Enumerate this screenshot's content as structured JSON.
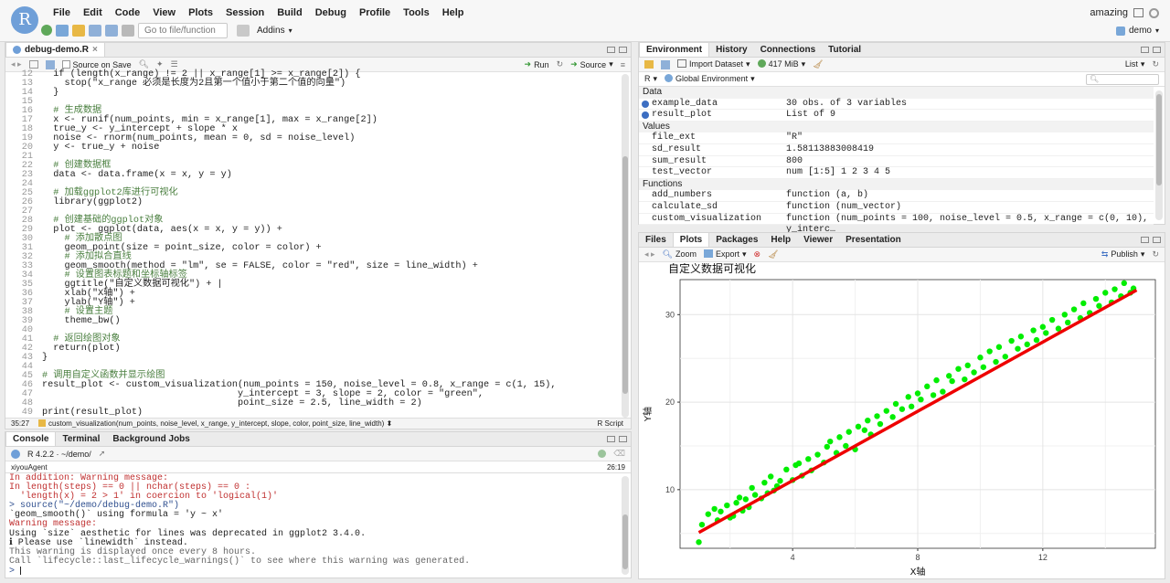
{
  "app": {
    "logo": "R",
    "menus": [
      "File",
      "Edit",
      "Code",
      "View",
      "Plots",
      "Session",
      "Build",
      "Debug",
      "Profile",
      "Tools",
      "Help"
    ],
    "goto_placeholder": "Go to file/function",
    "addins": "Addins",
    "user": "amazing",
    "project": "demo"
  },
  "editor": {
    "tab": "debug-demo.R",
    "source_on_save": "Source on Save",
    "run": "Run",
    "source": "Source",
    "status_pos": "35:27",
    "status_fn": "custom_visualization(num_points, noise_level, x_range, y_intercept, slope, color, point_size, line_width) ⬍",
    "status_lang": "R Script",
    "lines": [
      {
        "n": "12",
        "t": "  if (length(x_range) != 2 || x_range[1] >= x_range[2]) {"
      },
      {
        "n": "13",
        "t": "    stop(\"x_range 必须是长度为2且第一个值小于第二个值的向量\")"
      },
      {
        "n": "14",
        "t": "  }"
      },
      {
        "n": "15",
        "t": ""
      },
      {
        "n": "16",
        "t": "  # 生成数据"
      },
      {
        "n": "17",
        "t": "  x <- runif(num_points, min = x_range[1], max = x_range[2])"
      },
      {
        "n": "18",
        "t": "  true_y <- y_intercept + slope * x"
      },
      {
        "n": "19",
        "t": "  noise <- rnorm(num_points, mean = 0, sd = noise_level)"
      },
      {
        "n": "20",
        "t": "  y <- true_y + noise"
      },
      {
        "n": "21",
        "t": ""
      },
      {
        "n": "22",
        "t": "  # 创建数据框"
      },
      {
        "n": "23",
        "t": "  data <- data.frame(x = x, y = y)"
      },
      {
        "n": "24",
        "t": ""
      },
      {
        "n": "25",
        "t": "  # 加载ggplot2库进行可视化"
      },
      {
        "n": "26",
        "t": "  library(ggplot2)"
      },
      {
        "n": "27",
        "t": ""
      },
      {
        "n": "28",
        "t": "  # 创建基础的ggplot对象"
      },
      {
        "n": "29",
        "t": "  plot <- ggplot(data, aes(x = x, y = y)) +"
      },
      {
        "n": "30",
        "t": "    # 添加散点图"
      },
      {
        "n": "31",
        "t": "    geom_point(size = point_size, color = color) +"
      },
      {
        "n": "32",
        "t": "    # 添加拟合直线"
      },
      {
        "n": "33",
        "t": "    geom_smooth(method = \"lm\", se = FALSE, color = \"red\", size = line_width) +"
      },
      {
        "n": "34",
        "t": "    # 设置图表标题和坐标轴标签"
      },
      {
        "n": "35",
        "t": "    ggtitle(\"自定义数据可视化\") + |"
      },
      {
        "n": "36",
        "t": "    xlab(\"X轴\") +"
      },
      {
        "n": "37",
        "t": "    ylab(\"Y轴\") +"
      },
      {
        "n": "38",
        "t": "    # 设置主题"
      },
      {
        "n": "39",
        "t": "    theme_bw()"
      },
      {
        "n": "40",
        "t": ""
      },
      {
        "n": "41",
        "t": "  # 返回绘图对象"
      },
      {
        "n": "42",
        "t": "  return(plot)"
      },
      {
        "n": "43",
        "t": "}"
      },
      {
        "n": "44",
        "t": ""
      },
      {
        "n": "45",
        "t": "# 调用自定义函数并显示绘图"
      },
      {
        "n": "46",
        "t": "result_plot <- custom_visualization(num_points = 150, noise_level = 0.8, x_range = c(1, 15),"
      },
      {
        "n": "47",
        "t": "                                   y_intercept = 3, slope = 2, color = \"green\","
      },
      {
        "n": "48",
        "t": "                                   point_size = 2.5, line_width = 2)"
      },
      {
        "n": "49",
        "t": "print(result_plot)"
      }
    ]
  },
  "console": {
    "tabs": [
      "Console",
      "Terminal",
      "Background Jobs"
    ],
    "rversion": "R 4.2.2 · ~/demo/",
    "agent": "xiyouAgent",
    "agent_pos": "26:19",
    "lines": [
      {
        "t": "In addition: Warning message:",
        "c": "#c03030"
      },
      {
        "t": "In length(steps) == 0 || nchar(steps) == 0 :",
        "c": "#c03030"
      },
      {
        "t": "  'length(x) = 2 > 1' in coercion to 'logical(1)'",
        "c": "#c03030"
      },
      {
        "t": "> source(\"~/demo/debug-demo.R\")",
        "c": "#2f4f8f"
      },
      {
        "t": "`geom_smooth()` using formula = 'y ~ x'",
        "c": "#222"
      },
      {
        "t": "Warning message:",
        "c": "#c03030"
      },
      {
        "t": "Using `size` aesthetic for lines was deprecated in ggplot2 3.4.0.",
        "c": "#222"
      },
      {
        "t": "ℹ Please use `linewidth` instead.",
        "c": "#222"
      },
      {
        "t": "This warning is displayed once every 8 hours.",
        "c": "#666"
      },
      {
        "t": "Call `lifecycle::last_lifecycle_warnings()` to see where this warning was generated.",
        "c": "#666"
      },
      {
        "t": "> ",
        "c": "#2f4f8f"
      }
    ]
  },
  "env": {
    "tabs": [
      "Environment",
      "History",
      "Connections",
      "Tutorial"
    ],
    "import": "Import Dataset",
    "mem": "417 MiB",
    "list": "List",
    "lang": "R",
    "scope": "Global Environment",
    "sections": {
      "data": "Data",
      "values": "Values",
      "functions": "Functions"
    },
    "data": [
      {
        "k": "example_data",
        "v": "30 obs. of 3 variables"
      },
      {
        "k": "result_plot",
        "v": "List of  9"
      }
    ],
    "values": [
      {
        "k": "file_ext",
        "v": "\"R\""
      },
      {
        "k": "sd_result",
        "v": "1.58113883008419"
      },
      {
        "k": "sum_result",
        "v": "800"
      },
      {
        "k": "test_vector",
        "v": "num [1:5] 1 2 3 4 5"
      }
    ],
    "functions": [
      {
        "k": "add_numbers",
        "v": "function (a, b)"
      },
      {
        "k": "calculate_sd",
        "v": "function (num_vector)"
      },
      {
        "k": "custom_visualization",
        "v": "function (num_points = 100, noise_level = 0.5, x_range = c(0, 10), y_interc…"
      }
    ]
  },
  "files": {
    "tabs": [
      "Files",
      "Plots",
      "Packages",
      "Help",
      "Viewer",
      "Presentation"
    ],
    "zoom": "Zoom",
    "export": "Export",
    "publish": "Publish"
  },
  "chart_data": {
    "type": "scatter",
    "title": "自定义数据可视化",
    "xlabel": "X轴",
    "ylabel": "Y轴",
    "xlim": [
      0.4,
      15.6
    ],
    "ylim": [
      3.3,
      34.0
    ],
    "xticks": [
      4,
      8,
      12
    ],
    "yticks": [
      10,
      20,
      30
    ],
    "grid": true,
    "point_color": "#00ee00",
    "line_color": "#ee0000",
    "fit": {
      "x": [
        1,
        15
      ],
      "y": [
        5.1,
        32.8
      ]
    },
    "series": [
      {
        "x": [
          1.0,
          1.1,
          1.3,
          1.5,
          1.6,
          1.7,
          1.9,
          2.0,
          2.1,
          2.2,
          2.3,
          2.4,
          2.5,
          2.6,
          2.7,
          2.8,
          3.0,
          3.1,
          3.2,
          3.3,
          3.4,
          3.5,
          3.6,
          3.8,
          4.0,
          4.1,
          4.2,
          4.3,
          4.5,
          4.6,
          4.8,
          5.0,
          5.1,
          5.2,
          5.4,
          5.5,
          5.7,
          5.8,
          6.0,
          6.1,
          6.3,
          6.4,
          6.5,
          6.7,
          6.8,
          7.0,
          7.2,
          7.3,
          7.5,
          7.7,
          7.8,
          8.0,
          8.1,
          8.3,
          8.5,
          8.6,
          8.8,
          9.0,
          9.1,
          9.3,
          9.5,
          9.6,
          9.8,
          10.0,
          10.1,
          10.3,
          10.5,
          10.6,
          10.8,
          11.0,
          11.2,
          11.3,
          11.5,
          11.7,
          11.8,
          12.0,
          12.1,
          12.3,
          12.5,
          12.7,
          12.8,
          13.0,
          13.2,
          13.3,
          13.5,
          13.7,
          13.8,
          14.0,
          14.2,
          14.3,
          14.5,
          14.6,
          14.8,
          14.9
        ],
        "y": [
          4.0,
          6.0,
          7.2,
          7.8,
          6.5,
          7.5,
          8.2,
          6.8,
          7.0,
          8.5,
          9.1,
          7.6,
          8.9,
          8.0,
          10.2,
          9.4,
          9.0,
          10.8,
          9.6,
          11.5,
          9.9,
          10.4,
          11.0,
          12.3,
          11.1,
          12.8,
          13.0,
          11.6,
          13.5,
          12.2,
          14.0,
          13.1,
          14.9,
          15.5,
          14.2,
          16.0,
          15.0,
          16.6,
          14.6,
          17.2,
          16.8,
          17.9,
          16.3,
          18.4,
          17.5,
          19.0,
          18.3,
          19.8,
          19.2,
          20.6,
          19.5,
          21.0,
          20.3,
          21.8,
          20.8,
          22.5,
          21.2,
          23.0,
          22.4,
          23.8,
          22.6,
          24.2,
          23.4,
          25.1,
          24.0,
          25.8,
          24.6,
          26.3,
          25.2,
          27.0,
          26.1,
          27.5,
          26.6,
          28.2,
          27.1,
          28.6,
          27.9,
          29.4,
          28.4,
          30.0,
          29.1,
          30.6,
          29.6,
          31.3,
          30.2,
          31.8,
          31.0,
          32.5,
          31.4,
          32.9,
          32.1,
          33.6,
          32.5,
          33.0
        ]
      }
    ]
  }
}
